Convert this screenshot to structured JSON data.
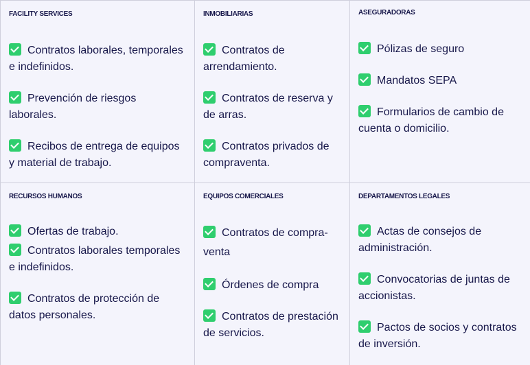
{
  "cells": [
    {
      "title": "FACILITY SERVICES",
      "items": [
        "Contratos laborales, temporales e indefinidos.",
        "Prevención de riesgos laborales.",
        "Recibos de entrega de equipos y material de trabajo."
      ]
    },
    {
      "title": "INMOBILIARIAS",
      "items": [
        "Contratos de arrendamiento.",
        "Contratos de reserva y de arras.",
        "Contratos privados de compraventa."
      ]
    },
    {
      "title": "ASEGURADORAS",
      "items": [
        "Pólizas de seguro",
        "Mandatos SEPA",
        "Formularios de cambio de cuenta o domicilio."
      ]
    },
    {
      "title": "RECURSOS HUMANOS",
      "items": [
        "Ofertas de trabajo.",
        "Contratos laborales temporales e indefinidos.",
        "Contratos de protección de datos personales."
      ]
    },
    {
      "title": "EQUIPOS COMERCIALES",
      "items": [
        "Contratos de compra-venta",
        "Órdenes de compra",
        "Contratos de prestación de servicios."
      ]
    },
    {
      "title": "DEPARTAMENTOS LEGALES",
      "items": [
        "Actas de consejos de administración.",
        "Convocatorias de juntas de accionistas.",
        "Pactos de socios y contratos de inversión."
      ]
    }
  ],
  "icon": "check-square-icon",
  "colors": {
    "check": "#2fce6e",
    "text": "#17174a",
    "background": "#f4f4fc"
  }
}
